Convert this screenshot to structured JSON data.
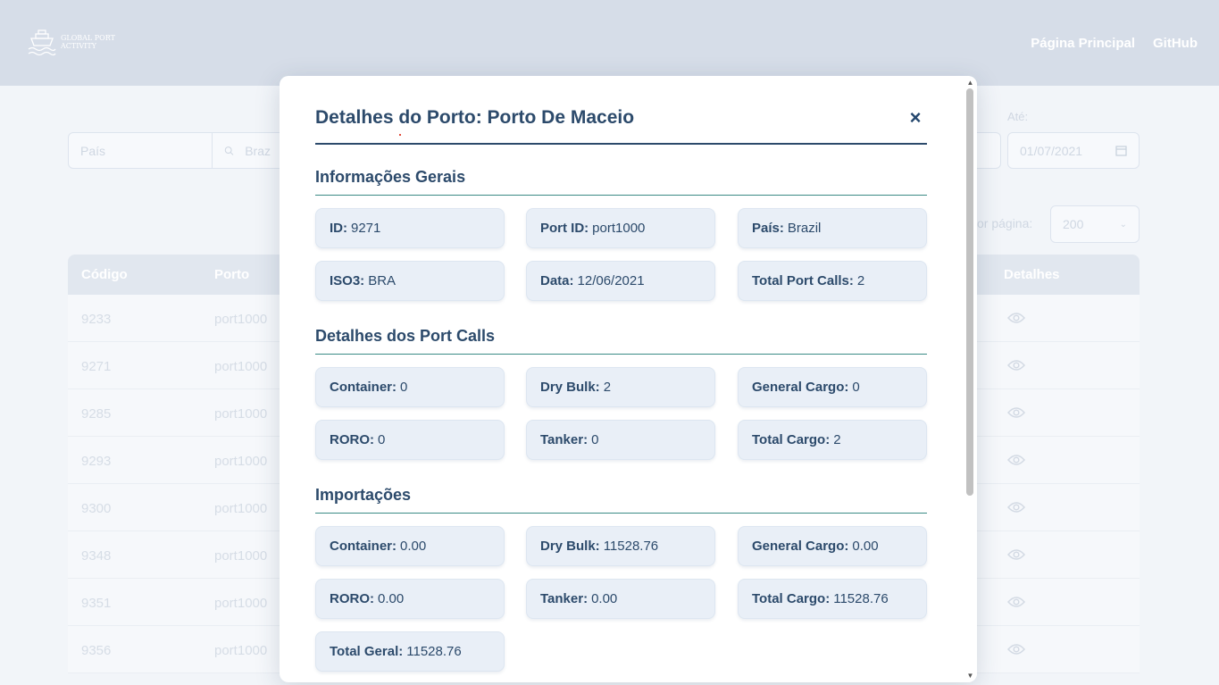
{
  "header": {
    "logo_text": "Global Port Activity",
    "nav": [
      "Página Principal",
      "GitHub"
    ]
  },
  "filters": {
    "country_placeholder": "País",
    "search_value": "Braz",
    "until_label": "Até:",
    "until_value": "01/07/2021",
    "per_page_label": "or página:",
    "per_page_value": "200"
  },
  "table": {
    "headers": [
      "Código",
      "Porto",
      "Detalhes"
    ],
    "rows": [
      {
        "code": "9233",
        "port": "port1000"
      },
      {
        "code": "9271",
        "port": "port1000"
      },
      {
        "code": "9285",
        "port": "port1000"
      },
      {
        "code": "9293",
        "port": "port1000"
      },
      {
        "code": "9300",
        "port": "port1000"
      },
      {
        "code": "9348",
        "port": "port1000"
      },
      {
        "code": "9351",
        "port": "port1000"
      },
      {
        "code": "9356",
        "port": "port1000"
      }
    ]
  },
  "modal": {
    "title": "Detalhes do Porto: Porto De Maceio",
    "close_icon": "×",
    "sections": [
      {
        "title": "Informações Gerais",
        "cards": [
          {
            "label": "ID:",
            "value": "9271"
          },
          {
            "label": "Port ID:",
            "value": "port1000"
          },
          {
            "label": "País:",
            "value": "Brazil"
          },
          {
            "label": "ISO3:",
            "value": "BRA"
          },
          {
            "label": "Data:",
            "value": "12/06/2021"
          },
          {
            "label": "Total Port Calls:",
            "value": "2"
          }
        ]
      },
      {
        "title": "Detalhes dos Port Calls",
        "cards": [
          {
            "label": "Container:",
            "value": "0"
          },
          {
            "label": "Dry Bulk:",
            "value": "2"
          },
          {
            "label": "General Cargo:",
            "value": "0"
          },
          {
            "label": "RORO:",
            "value": "0"
          },
          {
            "label": "Tanker:",
            "value": "0"
          },
          {
            "label": "Total Cargo:",
            "value": "2"
          }
        ]
      },
      {
        "title": "Importações",
        "cards": [
          {
            "label": "Container:",
            "value": "0.00"
          },
          {
            "label": "Dry Bulk:",
            "value": "11528.76"
          },
          {
            "label": "General Cargo:",
            "value": "0.00"
          },
          {
            "label": "RORO:",
            "value": "0.00"
          },
          {
            "label": "Tanker:",
            "value": "0.00"
          },
          {
            "label": "Total Cargo:",
            "value": "11528.76"
          },
          {
            "label": "Total Geral:",
            "value": "11528.76"
          }
        ]
      }
    ]
  }
}
